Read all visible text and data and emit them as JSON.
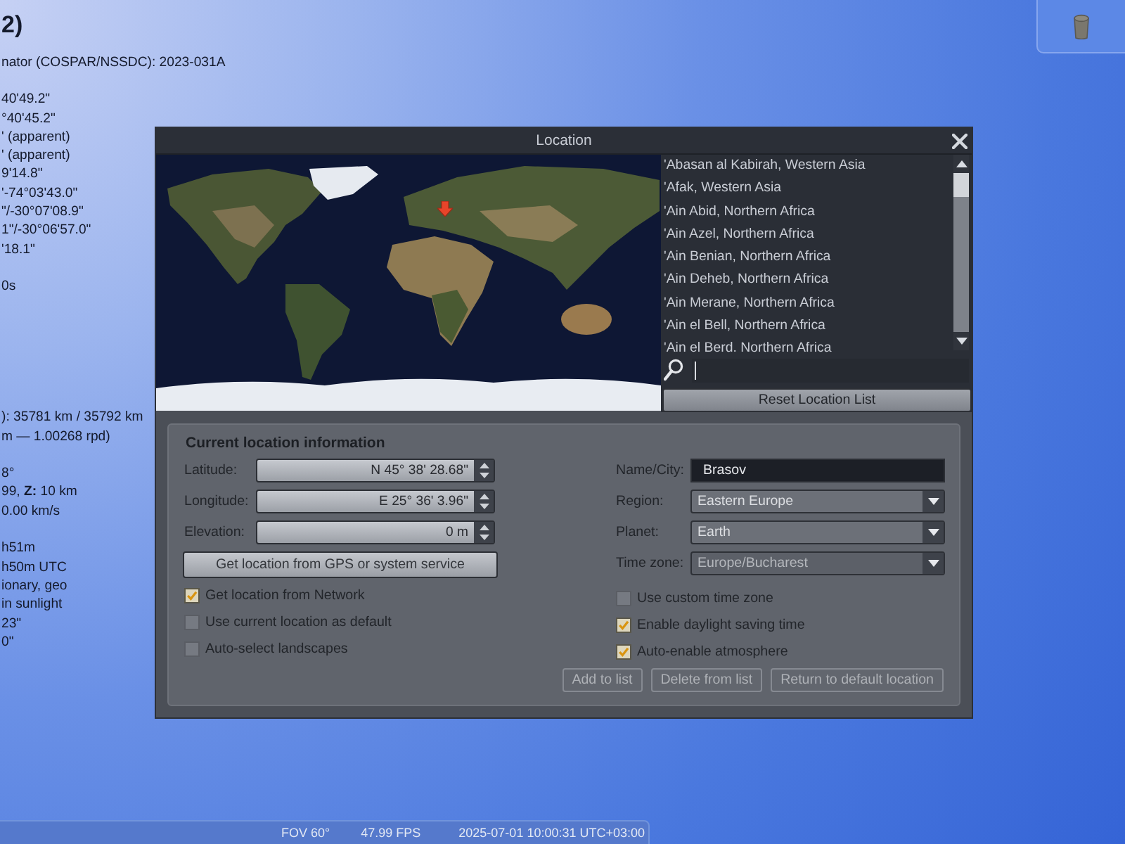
{
  "info_panel": {
    "title": "2)",
    "groups": [
      [
        "nator (COSPAR/NSSDC): 2023-031A"
      ],
      [
        "40'49.2\"",
        "°40'45.2\"",
        "' (apparent)",
        "' (apparent)",
        "9'14.8\"",
        "'-74°03'43.0\"",
        "\"/-30°07'08.9\"",
        "1\"/-30°06'57.0\"",
        "'18.1\""
      ],
      [
        "0s"
      ],
      [
        "): 35781 km / 35792 km",
        "m — 1.00268 rpd)"
      ],
      [
        "8°",
        "99, **Z:** 10 km",
        "0.00 km/s"
      ],
      [
        "h51m",
        "h50m UTC",
        "ionary, geo",
        "in sunlight",
        "23\"",
        "0\""
      ]
    ]
  },
  "location_dialog": {
    "title": "Location",
    "locations": [
      {
        "name": "'Abasan al Kabirah, Western Asia",
        "selected": false
      },
      {
        "name": "'Afak, Western Asia",
        "selected": false
      },
      {
        "name": "'Ain Abid, Northern Africa",
        "selected": false
      },
      {
        "name": "'Ain Azel, Northern Africa",
        "selected": false
      },
      {
        "name": "'Ain Benian, Northern Africa",
        "selected": false
      },
      {
        "name": "'Ain Deheb, Northern Africa",
        "selected": false
      },
      {
        "name": "'Ain Merane, Northern Africa",
        "selected": false
      },
      {
        "name": "'Ain el Bell, Northern Africa",
        "selected": false
      },
      {
        "name": "'Ain el Berd. Northern Africa",
        "selected": false
      }
    ],
    "reset_button": "Reset Location List",
    "current": {
      "title": "Current location information",
      "coordinates": [
        {
          "label": "Latitude:",
          "value": "N 45° 38' 28.68\""
        },
        {
          "label": "Longitude:",
          "value": "E 25° 36' 3.96\""
        },
        {
          "label": "Elevation:",
          "value": "0 m"
        }
      ],
      "gps_button": "Get location from GPS or system service",
      "left_options": [
        {
          "label": "Get location from Network",
          "checked": true
        },
        {
          "label": "Use current location as default",
          "checked": false
        },
        {
          "label": "Auto-select landscapes",
          "checked": false
        }
      ],
      "place_fields": [
        {
          "kind": "text",
          "label": "Name/City:",
          "value": "Brasov",
          "disabled": false
        },
        {
          "kind": "combo",
          "label": "Region:",
          "value": "Eastern Europe",
          "disabled": false
        },
        {
          "kind": "combo",
          "label": "Planet:",
          "value": "Earth",
          "disabled": false
        },
        {
          "kind": "combo",
          "label": "Time zone:",
          "value": "Europe/Bucharest",
          "disabled": true
        }
      ],
      "right_options": [
        {
          "label": "Use custom time zone",
          "checked": false
        },
        {
          "label": "Enable daylight saving time",
          "checked": true
        },
        {
          "label": "Auto-enable atmosphere",
          "checked": true
        }
      ],
      "list_buttons": [
        {
          "label": "Add to list",
          "disabled": true
        },
        {
          "label": "Delete from list",
          "disabled": true
        },
        {
          "label": "Return to default location",
          "disabled": true
        }
      ]
    }
  },
  "status_bar": {
    "fov": "FOV 60°",
    "fps": "47.99 FPS",
    "datetime": "2025-07-01 10:00:31 UTC+03:00"
  }
}
